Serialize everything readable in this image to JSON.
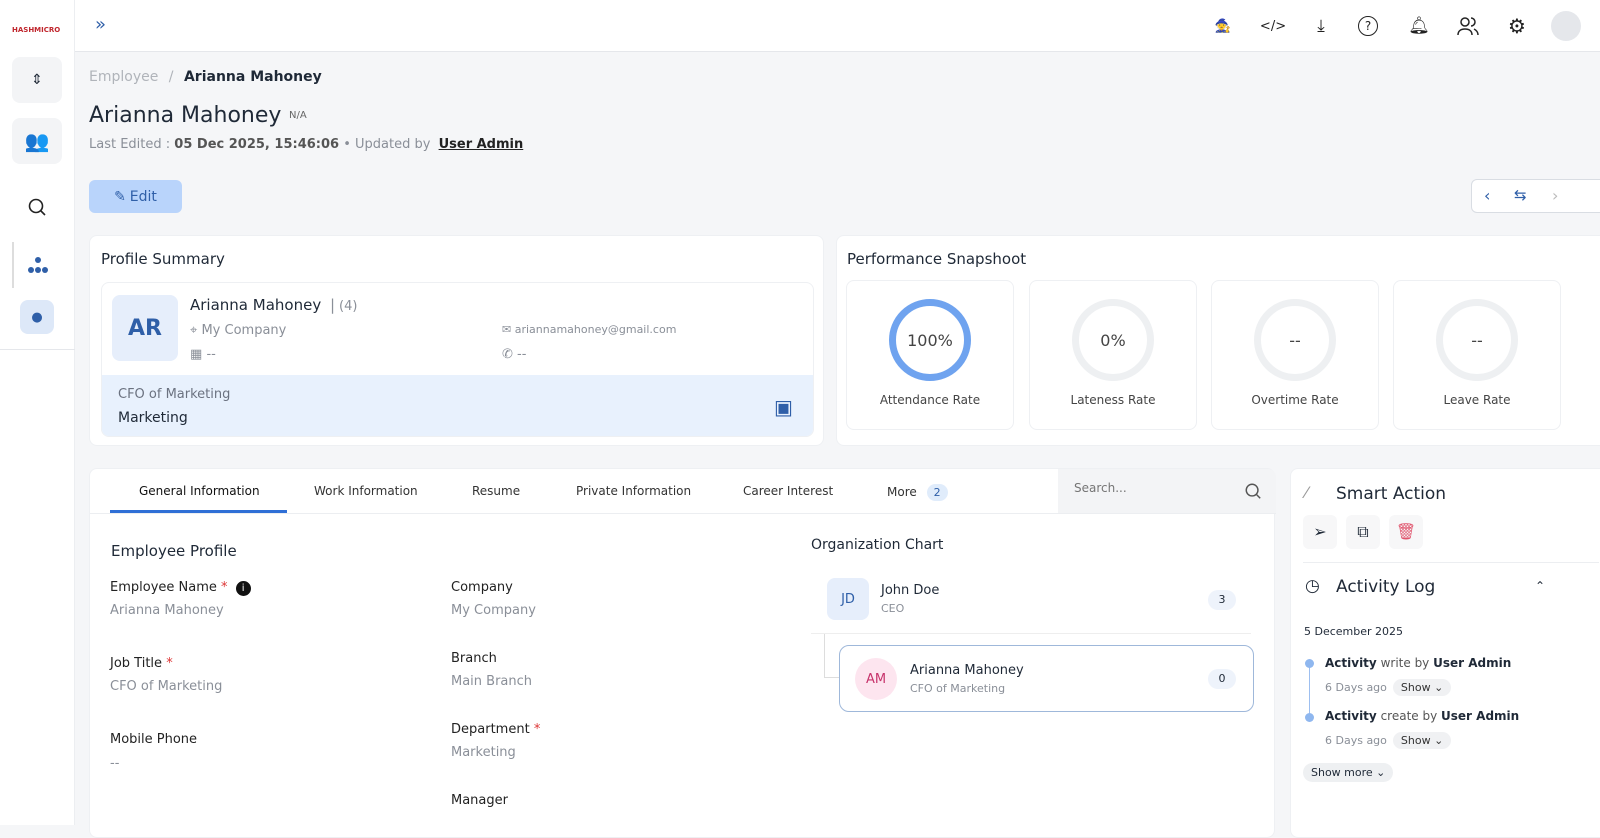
{
  "app": {
    "logo_text": "HASHMICRO"
  },
  "topbar": {
    "icons": [
      "wizard-hat-icon",
      "code-icon",
      "download-icon",
      "help-icon",
      "bell-icon",
      "users-icon",
      "gear-icon",
      "avatar-icon"
    ]
  },
  "breadcrumb": {
    "parent": "Employee",
    "separator": "/",
    "current": "Arianna Mahoney"
  },
  "header": {
    "title": "Arianna Mahoney",
    "badge": "N/A",
    "last_edited_label": "Last Edited :",
    "last_edited": "05 Dec 2025, 15:46:06",
    "updated_by_label": "Updated by",
    "updated_by": "User Admin",
    "edit_label": "Edit"
  },
  "profile": {
    "title": "Profile Summary",
    "initials": "AR",
    "name": "Arianna Mahoney",
    "separator": "|",
    "count": "(4)",
    "company": "My Company",
    "email": "ariannamahoney@gmail.com",
    "date": "--",
    "phone": "--",
    "job": "CFO of Marketing",
    "department": "Marketing"
  },
  "performance": {
    "title": "Performance Snapshoot",
    "kpis": [
      {
        "value": "100%",
        "label": "Attendance Rate",
        "fill": 100
      },
      {
        "value": "0%",
        "label": "Lateness Rate",
        "fill": 0
      },
      {
        "value": "--",
        "label": "Overtime Rate",
        "fill": 0
      },
      {
        "value": "--",
        "label": "Leave Rate",
        "fill": 0
      }
    ]
  },
  "tabs": {
    "items": [
      "General Information",
      "Work Information",
      "Resume",
      "Private Information",
      "Career Interest",
      "More"
    ],
    "more_count": "2",
    "active": "General Information",
    "search_placeholder": "Search..."
  },
  "employee_profile": {
    "title": "Employee Profile",
    "fields": [
      {
        "label": "Employee Name",
        "value": "Arianna Mahoney",
        "required": "*"
      },
      {
        "label": "Job Title",
        "value": "CFO of Marketing",
        "required": "*"
      },
      {
        "label": "Mobile Phone",
        "value": "--"
      },
      {
        "label": "Company",
        "value": "My Company"
      },
      {
        "label": "Branch",
        "value": "Main Branch"
      },
      {
        "label": "Department",
        "value": "Marketing",
        "required": "*"
      },
      {
        "label": "Manager"
      }
    ]
  },
  "org_chart": {
    "title": "Organization Chart",
    "nodes": [
      {
        "initials": "JD",
        "name": "John Doe",
        "role": "CEO",
        "count": "3"
      },
      {
        "initials": "AM",
        "name": "Arianna Mahoney",
        "role": "CFO of Marketing",
        "count": "0"
      }
    ]
  },
  "smart_action": {
    "title": "Smart Action"
  },
  "activity_log": {
    "title": "Activity Log",
    "date": "5 December 2025",
    "entries": [
      {
        "subject": "Activity",
        "action": "write by",
        "user": "User Admin",
        "time": "6 Days ago",
        "show": "Show"
      },
      {
        "subject": "Activity",
        "action": "create by",
        "user": "User Admin",
        "time": "6 Days ago",
        "show": "Show"
      }
    ],
    "show_more": "Show more"
  },
  "colors": {
    "accent": "#3b82f6",
    "edit_bg": "#b9d4fb",
    "highlight_bg": "#e8f1fd",
    "danger": "#e0566e"
  }
}
